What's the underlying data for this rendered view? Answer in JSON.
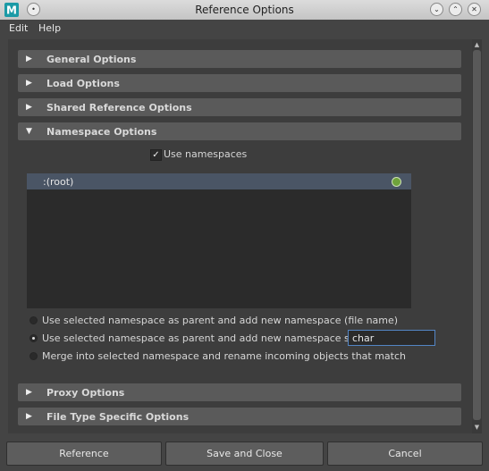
{
  "window": {
    "title": "Reference Options",
    "logo_letter": "M",
    "controls": {
      "minimize": "⌄",
      "maximize": "⌃",
      "close": "✕"
    }
  },
  "menu": {
    "items": [
      "Edit",
      "Help"
    ]
  },
  "sections": {
    "general": "General Options",
    "load": "Load Options",
    "shared": "Shared Reference Options",
    "namespace": "Namespace Options",
    "proxy": "Proxy Options",
    "filetype": "File Type Specific Options"
  },
  "namespace": {
    "use_namespaces_label": "Use namespaces",
    "use_namespaces_checked": true,
    "list_items": [
      ":(root)"
    ],
    "options": [
      "Use selected namespace as parent and add new namespace (file name)",
      "Use selected namespace as parent and add new namespace string:",
      "Merge into selected namespace and rename incoming objects that match"
    ],
    "selected_option": 1,
    "string_value": "char"
  },
  "buttons": {
    "reference": "Reference",
    "save_close": "Save and Close",
    "cancel": "Cancel"
  },
  "colors": {
    "accent_selection": "#4a5565",
    "status_green": "#6fa23b",
    "input_focus": "#5385c5"
  }
}
